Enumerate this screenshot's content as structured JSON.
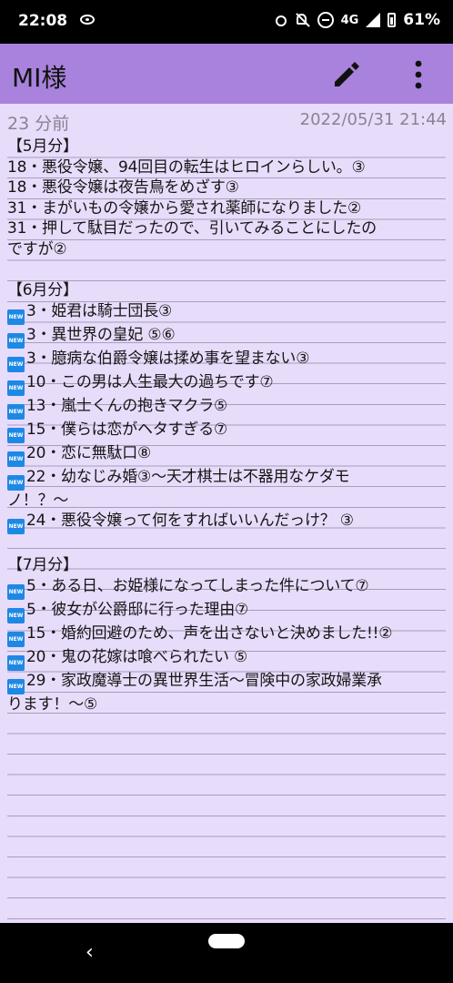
{
  "status_bar": {
    "time": "22:08",
    "network": "4G",
    "battery": "61%"
  },
  "app_bar": {
    "title": "MI様",
    "edit_icon": "pencil-icon",
    "more_icon": "more-vert-icon"
  },
  "meta": {
    "relative_time": "23 分前",
    "datetime": "2022/05/31 21:44"
  },
  "note": {
    "lines": [
      {
        "new": false,
        "text": "【5月分】"
      },
      {
        "new": false,
        "text": "18・悪役令嬢、94回目の転生はヒロインらしい。③"
      },
      {
        "new": false,
        "text": "18・悪役令嬢は夜告鳥をめざす③"
      },
      {
        "new": false,
        "text": "31・まがいもの令嬢から愛され薬師になりました②"
      },
      {
        "new": false,
        "text": "31・押して駄目だったので、引いてみることにしたの"
      },
      {
        "new": false,
        "text": "ですが②"
      },
      {
        "new": false,
        "text": ""
      },
      {
        "new": false,
        "text": "【6月分】"
      },
      {
        "new": true,
        "text": "3・姫君は騎士団長③"
      },
      {
        "new": true,
        "text": "3・異世界の皇妃 ⑤⑥"
      },
      {
        "new": true,
        "text": "3・臆病な伯爵令嬢は揉め事を望まない③"
      },
      {
        "new": true,
        "text": "10・この男は人生最大の過ちです⑦"
      },
      {
        "new": true,
        "text": "13・嵐士くんの抱きマクラ⑤"
      },
      {
        "new": true,
        "text": "15・僕らは恋がヘタすぎる⑦"
      },
      {
        "new": true,
        "text": "20・恋に無駄口⑧"
      },
      {
        "new": true,
        "text": "22・幼なじみ婚③〜天才棋士は不器用なケダモ"
      },
      {
        "new": false,
        "text": "ノ！？〜"
      },
      {
        "new": true,
        "text": "24・悪役令嬢って何をすればいいんだっけ？ ③"
      },
      {
        "new": false,
        "text": ""
      },
      {
        "new": false,
        "text": "【7月分】"
      },
      {
        "new": true,
        "text": "5・ある日、お姫様になってしまった件について⑦"
      },
      {
        "new": true,
        "text": "5・彼女が公爵邸に行った理由⑦"
      },
      {
        "new": true,
        "text": "15・婚約回避のため、声を出さないと決めました!!②"
      },
      {
        "new": true,
        "text": "20・鬼の花嫁は喰べられたい ⑤"
      },
      {
        "new": true,
        "text": "29・家政魔導士の異世界生活〜冒険中の家政婦業承"
      },
      {
        "new": false,
        "text": "ります！〜⑤"
      }
    ]
  },
  "nav_bar": {
    "back_icon": "back-icon",
    "home_icon": "home-pill-icon"
  }
}
